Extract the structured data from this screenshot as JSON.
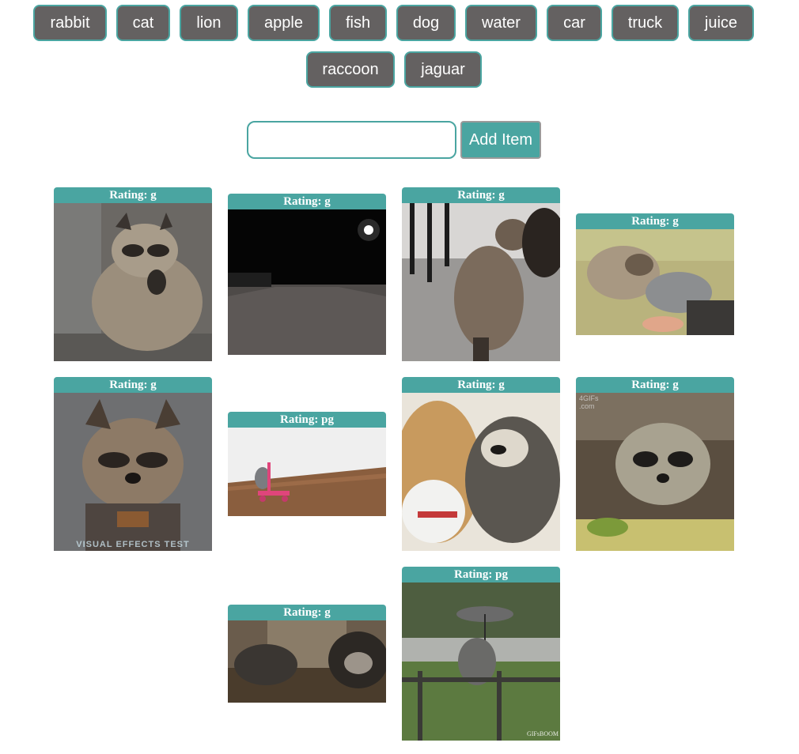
{
  "topic_buttons": [
    "rabbit",
    "cat",
    "lion",
    "apple",
    "fish",
    "dog",
    "water",
    "car",
    "truck",
    "juice",
    "raccoon",
    "jaguar"
  ],
  "search": {
    "value": "",
    "placeholder": ""
  },
  "add_button_label": "Add Item",
  "gifs": [
    {
      "rating_label": "Rating: g",
      "icon": "raccoon-sitting-image"
    },
    {
      "rating_label": "Rating: g",
      "icon": "night-road-image"
    },
    {
      "rating_label": "Rating: g",
      "icon": "raccoon-and-dog-image"
    },
    {
      "rating_label": "Rating: g",
      "icon": "raccoon-and-cat-bed-image"
    },
    {
      "rating_label": "Rating: g",
      "icon": "rocket-raccoon-image",
      "overlay_text": "VISUAL EFFECTS TEST"
    },
    {
      "rating_label": "Rating: pg",
      "icon": "raccoon-scooter-image"
    },
    {
      "rating_label": "Rating: g",
      "icon": "dog-and-raccoon-image"
    },
    {
      "rating_label": "Rating: g",
      "icon": "raccoon-chair-image",
      "overlay_text": "4GIFs .com"
    },
    {
      "rating_label": "Rating: g",
      "icon": "cat-and-raccoon-image"
    },
    {
      "rating_label": "Rating: pg",
      "icon": "raccoon-umbrella-image",
      "overlay_text": "GIFsBOOM"
    }
  ],
  "colors": {
    "accent": "#4aa5a1",
    "button_bg": "#646161",
    "button_text": "#ffffff"
  }
}
